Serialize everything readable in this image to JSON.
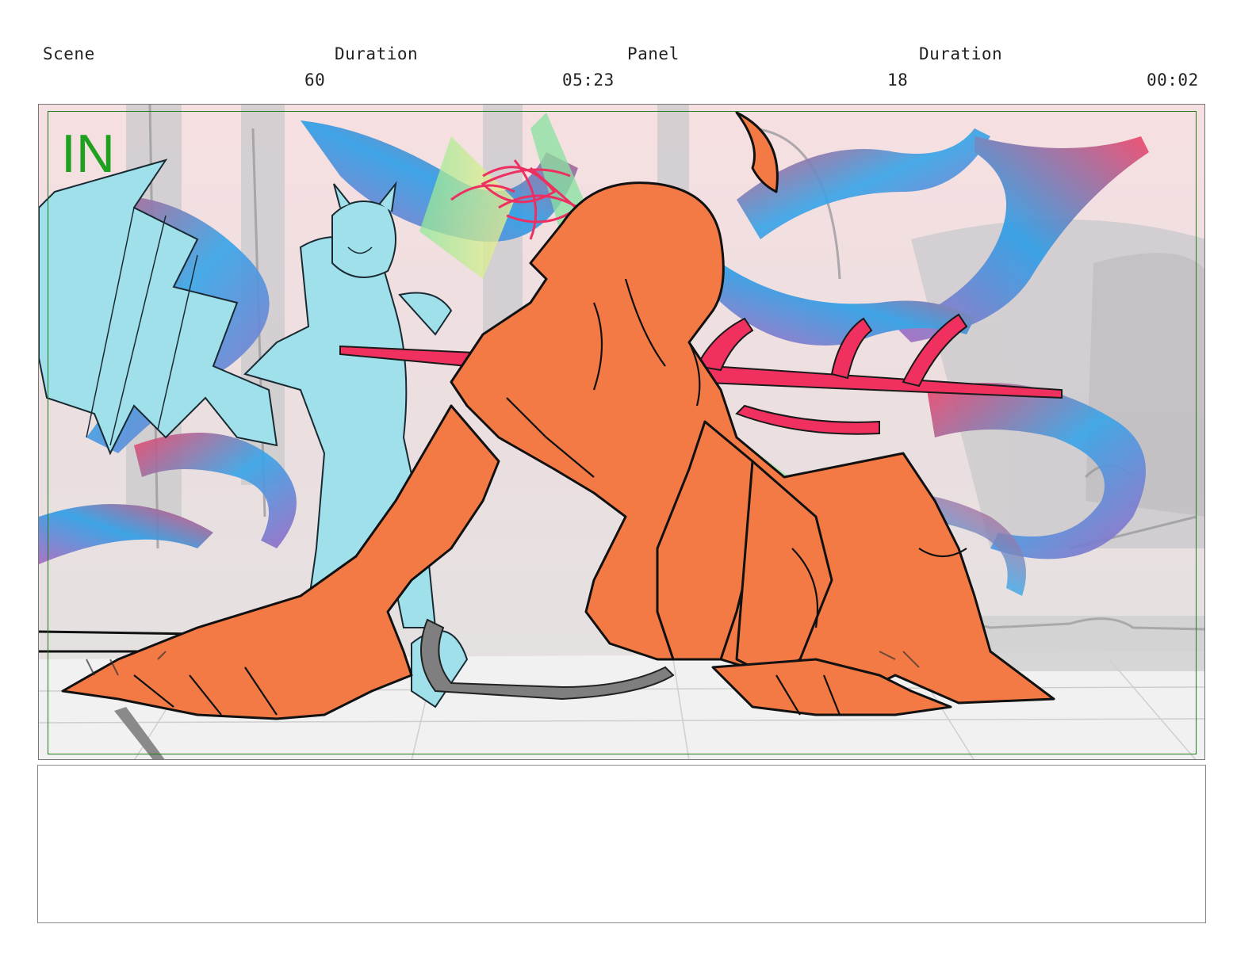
{
  "header": {
    "scene_label": "Scene",
    "scene_duration_label": "Duration",
    "panel_label": "Panel",
    "panel_duration_label": "Duration",
    "scene_value": "60",
    "scene_duration_value": "05:23",
    "panel_value": "18",
    "panel_duration_value": "00:02"
  },
  "panel": {
    "transition_label": "IN",
    "safe_frame_color": "#1f7a1f",
    "label_color": "#1fa01f",
    "figure_orange": "#f47a45",
    "figure_cyan": "#9fe0ea",
    "spear_red": "#f0305f"
  },
  "notes": {
    "text": ""
  }
}
